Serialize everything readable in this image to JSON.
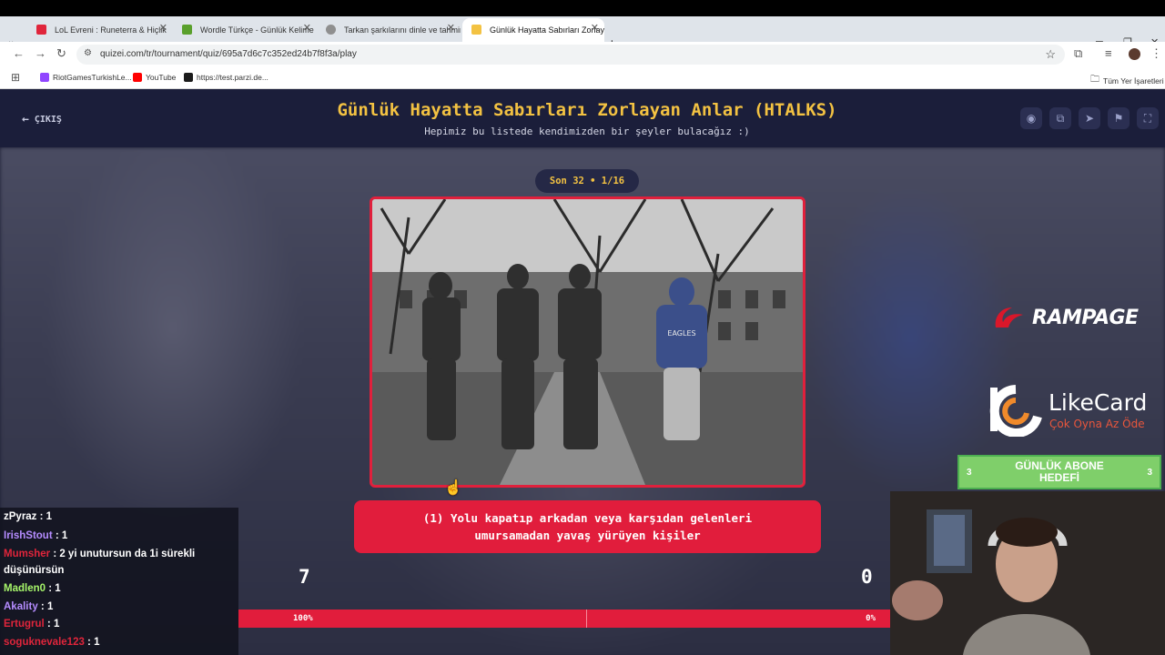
{
  "browser": {
    "tabs": [
      {
        "label": "LoL Evreni : Runeterra & Hiçlik",
        "icon_color": "#e0253b",
        "active": false
      },
      {
        "label": "Wordle Türkçe - Günlük Kelime",
        "icon_color": "#5aa02c",
        "active": false
      },
      {
        "label": "Tarkan şarkılarını dinle ve tahmin",
        "icon_color": "#8f8f8f",
        "active": false
      },
      {
        "label": "Günlük Hayatta Sabırları Zorlay",
        "icon_color": "#f3c242",
        "active": true
      }
    ],
    "new_tab_glyph": "+",
    "url": "quizei.com/tr/tournament/quiz/695a7d6c7c352ed24b7f8f3a/play",
    "bookmarks": [
      {
        "label": "RiotGamesTurkishLe...",
        "icon_color": "#9146ff"
      },
      {
        "label": "YouTube",
        "icon_color": "#ff0000"
      },
      {
        "label": "https://test.parzi.de...",
        "icon_color": "#1b1b1b"
      }
    ],
    "all_bookmarks_label": "Tüm Yer İşaretleri"
  },
  "header": {
    "exit_label": "ÇIKIŞ",
    "title": "Günlük Hayatta Sabırları Zorlayan Anlar (HTALKS)",
    "subtitle": "Hepimiz bu listede kendimizden bir şeyler bulacağız :)",
    "icons": [
      "eye-icon",
      "share-icon",
      "send-icon",
      "flag-icon",
      "fullscreen-icon"
    ]
  },
  "round": {
    "label": "Son 32 • 1/16"
  },
  "option": {
    "label": "(1) Yolu kapatıp arkadan veya karşıdan gelenleri\numursamadan yavaş yürüyen kişiler"
  },
  "votes": {
    "left_count": "7",
    "right_count": "0",
    "left_percent": "100%",
    "right_percent": "0%",
    "bar_color": "#e11d3c"
  },
  "overlays": {
    "rampage": "RAMPAGE",
    "likecard_name": "LikeCard",
    "likecard_slogan": "Çok Oyna  Az Öde",
    "goal_title": "GÜNLÜK ABONE\nHEDEFİ",
    "goal_left": "3",
    "goal_right": "3"
  },
  "chat": [
    {
      "user": "zPyraz",
      "text": " : 1",
      "color": "#ffffff"
    },
    {
      "user": "IrishStout",
      "text": " : 1",
      "color": "#b58cff"
    },
    {
      "user": "Mumsher",
      "text": " : 2 yi unutursun da 1i sürekli",
      "color": "#e0253b"
    },
    {
      "user": "",
      "text": "düşünürsün",
      "color": "#ffffff"
    },
    {
      "user": "Madlen0",
      "text": " : 1",
      "color": "#a6f56a"
    },
    {
      "user": "Akality",
      "text": " : 1",
      "color": "#b58cff"
    },
    {
      "user": "Ertugrul",
      "text": " : 1",
      "color": "#e0253b"
    },
    {
      "user": "soguknevale123",
      "text": " : 1",
      "color": "#e0253b"
    }
  ]
}
